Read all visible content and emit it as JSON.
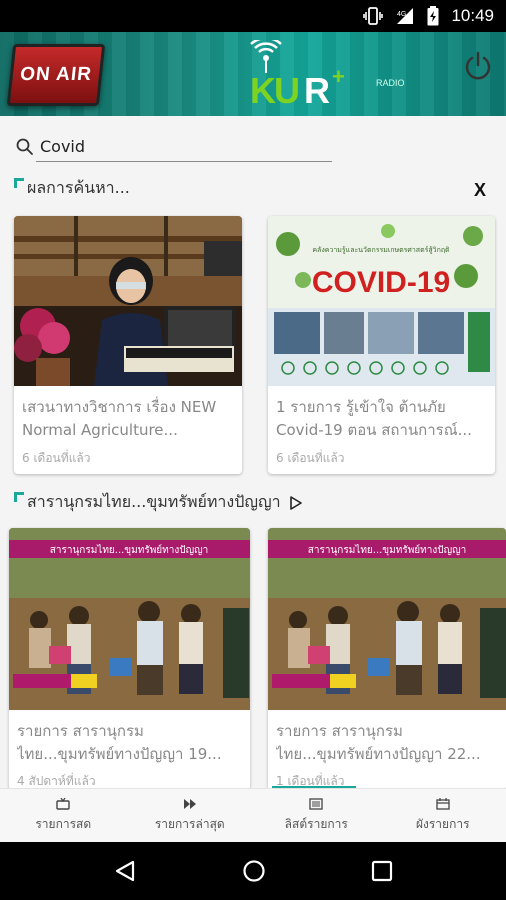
{
  "status_bar": {
    "time": "10:49",
    "network": "4G"
  },
  "banner": {
    "on_air": "ON AIR",
    "logo_k": "KU",
    "logo_r": "R",
    "logo_plus": "+",
    "radio": "RADIO"
  },
  "search": {
    "value": "Covid",
    "placeholder": ""
  },
  "results": {
    "heading": "ผลการค้นหา...",
    "close": "X",
    "cards": [
      {
        "title": "เสวนาทางวิชาการ เรื่อง NEW Normal Agriculture...",
        "time": "6 เดือนที่แล้ว"
      },
      {
        "title": "1 รายการ รู้เข้าใจ ต้านภัย Covid-19 ตอน สถานการณ์...",
        "time": "6 เดือนที่แล้ว",
        "thumb_text": "COVID-19",
        "thumb_sub": "คลังความรู้และนวัตกรรมเกษตรศาสตร์สู้วิกฤติ"
      }
    ]
  },
  "program": {
    "heading": "สารานุกรมไทย...ขุมทรัพย์ทางปัญญา",
    "thumb_banner": "สารานุกรมไทย...ขุมทรัพย์ทางปัญญา",
    "cards": [
      {
        "title": "รายการ สารานุกรม ไทย...ขุมทรัพย์ทางปัญญา 19...",
        "time": "4 สัปดาห์ที่แล้ว"
      },
      {
        "title": "รายการ สารานุกรม ไทย...ขุมทรัพย์ทางปัญญา 22...",
        "time": "1 เดือนที่แล้ว"
      }
    ]
  },
  "bottom_nav": [
    {
      "label": "รายการสด",
      "icon": "tv-icon"
    },
    {
      "label": "รายการล่าสุด",
      "icon": "fast-forward-icon"
    },
    {
      "label": "ลิสต์รายการ",
      "icon": "list-icon"
    },
    {
      "label": "ผังรายการ",
      "icon": "calendar-icon"
    }
  ],
  "colors": {
    "accent": "#1aa89b",
    "banner": "#14a89b",
    "logo_green": "#7ed321"
  }
}
